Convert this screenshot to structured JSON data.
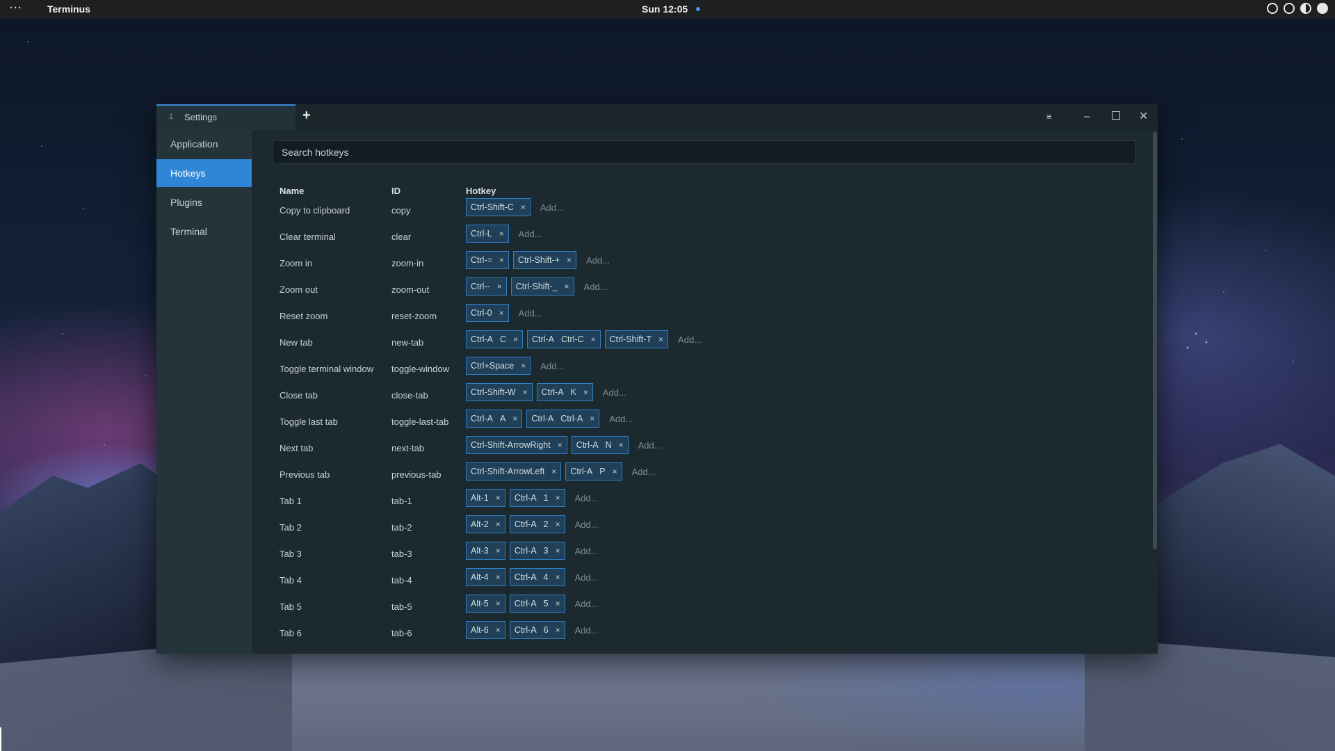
{
  "topbar": {
    "activities": "···",
    "app_name": "Terminus",
    "clock": "Sun 12:05"
  },
  "window": {
    "tab": {
      "number": "1",
      "label": "Settings"
    },
    "new_tab_label": "+"
  },
  "sidebar": {
    "items": [
      {
        "label": "Application"
      },
      {
        "label": "Hotkeys",
        "active": true
      },
      {
        "label": "Plugins"
      },
      {
        "label": "Terminal"
      }
    ]
  },
  "search": {
    "placeholder": "Search hotkeys"
  },
  "table": {
    "headers": {
      "name": "Name",
      "id": "ID",
      "hotkey": "Hotkey"
    },
    "add_label": "Add...",
    "rows": [
      {
        "name": "Copy to clipboard",
        "id": "copy",
        "hotkeys": [
          [
            "Ctrl-Shift-C"
          ]
        ]
      },
      {
        "name": "Clear terminal",
        "id": "clear",
        "hotkeys": [
          [
            "Ctrl-L"
          ]
        ]
      },
      {
        "name": "Zoom in",
        "id": "zoom-in",
        "hotkeys": [
          [
            "Ctrl-="
          ],
          [
            "Ctrl-Shift-+"
          ]
        ]
      },
      {
        "name": "Zoom out",
        "id": "zoom-out",
        "hotkeys": [
          [
            "Ctrl--"
          ],
          [
            "Ctrl-Shift-_"
          ]
        ]
      },
      {
        "name": "Reset zoom",
        "id": "reset-zoom",
        "hotkeys": [
          [
            "Ctrl-0"
          ]
        ]
      },
      {
        "name": "New tab",
        "id": "new-tab",
        "hotkeys": [
          [
            "Ctrl-A",
            "C"
          ],
          [
            "Ctrl-A",
            "Ctrl-C"
          ],
          [
            "Ctrl-Shift-T"
          ]
        ]
      },
      {
        "name": "Toggle terminal window",
        "id": "toggle-window",
        "hotkeys": [
          [
            "Ctrl+Space"
          ]
        ]
      },
      {
        "name": "Close tab",
        "id": "close-tab",
        "hotkeys": [
          [
            "Ctrl-Shift-W"
          ],
          [
            "Ctrl-A",
            "K"
          ]
        ]
      },
      {
        "name": "Toggle last tab",
        "id": "toggle-last-tab",
        "hotkeys": [
          [
            "Ctrl-A",
            "A"
          ],
          [
            "Ctrl-A",
            "Ctrl-A"
          ]
        ]
      },
      {
        "name": "Next tab",
        "id": "next-tab",
        "hotkeys": [
          [
            "Ctrl-Shift-ArrowRight"
          ],
          [
            "Ctrl-A",
            "N"
          ]
        ]
      },
      {
        "name": "Previous tab",
        "id": "previous-tab",
        "hotkeys": [
          [
            "Ctrl-Shift-ArrowLeft"
          ],
          [
            "Ctrl-A",
            "P"
          ]
        ]
      },
      {
        "name": "Tab 1",
        "id": "tab-1",
        "hotkeys": [
          [
            "Alt-1"
          ],
          [
            "Ctrl-A",
            "1"
          ]
        ]
      },
      {
        "name": "Tab 2",
        "id": "tab-2",
        "hotkeys": [
          [
            "Alt-2"
          ],
          [
            "Ctrl-A",
            "2"
          ]
        ]
      },
      {
        "name": "Tab 3",
        "id": "tab-3",
        "hotkeys": [
          [
            "Alt-3"
          ],
          [
            "Ctrl-A",
            "3"
          ]
        ]
      },
      {
        "name": "Tab 4",
        "id": "tab-4",
        "hotkeys": [
          [
            "Alt-4"
          ],
          [
            "Ctrl-A",
            "4"
          ]
        ]
      },
      {
        "name": "Tab 5",
        "id": "tab-5",
        "hotkeys": [
          [
            "Alt-5"
          ],
          [
            "Ctrl-A",
            "5"
          ]
        ]
      },
      {
        "name": "Tab 6",
        "id": "tab-6",
        "hotkeys": [
          [
            "Alt-6"
          ],
          [
            "Ctrl-A",
            "6"
          ]
        ]
      }
    ]
  },
  "icons": {
    "remove": "×",
    "close": "✕",
    "minimize": "–",
    "settings": "≡"
  },
  "colors": {
    "accent": "#2f86d8",
    "chip_border": "#2f7fc7",
    "chip_bg": "#1f4058",
    "window_bg": "#1c2a30",
    "sidebar_bg": "#24343a"
  }
}
